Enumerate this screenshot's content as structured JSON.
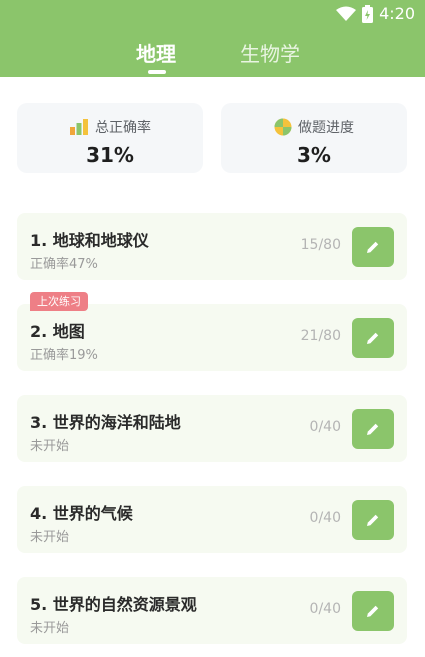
{
  "status_bar": {
    "time": "4:20"
  },
  "tabs": [
    {
      "label": "地理",
      "active": true
    },
    {
      "label": "生物学",
      "active": false
    }
  ],
  "stats": {
    "accuracy": {
      "label": "总正确率",
      "value": "31%",
      "icon": "bar-chart-icon"
    },
    "progress": {
      "label": "做题进度",
      "value": "3%",
      "icon": "pie-chart-icon"
    }
  },
  "last_practice_tag": "上次练习",
  "chapters": [
    {
      "title": "1. 地球和地球仪",
      "subtitle": "正确率47%",
      "count": "15/80"
    },
    {
      "title": "2. 地图",
      "subtitle": "正确率19%",
      "count": "21/80"
    },
    {
      "title": "3. 世界的海洋和陆地",
      "subtitle": "未开始",
      "count": "0/40"
    },
    {
      "title": "4. 世界的气候",
      "subtitle": "未开始",
      "count": "0/40"
    },
    {
      "title": "5. 世界的自然资源景观",
      "subtitle": "未开始",
      "count": "0/40"
    }
  ],
  "colors": {
    "primary_green": "#8bc56b",
    "tag_red": "#ee7f86",
    "card_bg": "#f6faf1"
  }
}
